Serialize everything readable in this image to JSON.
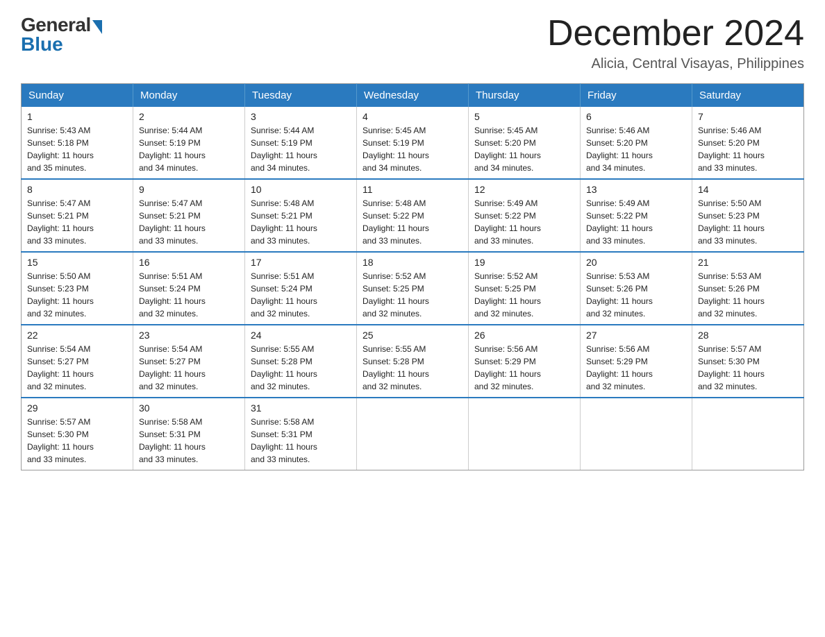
{
  "logo": {
    "general": "General",
    "blue": "Blue"
  },
  "header": {
    "month_title": "December 2024",
    "subtitle": "Alicia, Central Visayas, Philippines"
  },
  "days_of_week": [
    "Sunday",
    "Monday",
    "Tuesday",
    "Wednesday",
    "Thursday",
    "Friday",
    "Saturday"
  ],
  "weeks": [
    [
      {
        "day": "1",
        "sunrise": "5:43 AM",
        "sunset": "5:18 PM",
        "daylight": "11 hours and 35 minutes."
      },
      {
        "day": "2",
        "sunrise": "5:44 AM",
        "sunset": "5:19 PM",
        "daylight": "11 hours and 34 minutes."
      },
      {
        "day": "3",
        "sunrise": "5:44 AM",
        "sunset": "5:19 PM",
        "daylight": "11 hours and 34 minutes."
      },
      {
        "day": "4",
        "sunrise": "5:45 AM",
        "sunset": "5:19 PM",
        "daylight": "11 hours and 34 minutes."
      },
      {
        "day": "5",
        "sunrise": "5:45 AM",
        "sunset": "5:20 PM",
        "daylight": "11 hours and 34 minutes."
      },
      {
        "day": "6",
        "sunrise": "5:46 AM",
        "sunset": "5:20 PM",
        "daylight": "11 hours and 34 minutes."
      },
      {
        "day": "7",
        "sunrise": "5:46 AM",
        "sunset": "5:20 PM",
        "daylight": "11 hours and 33 minutes."
      }
    ],
    [
      {
        "day": "8",
        "sunrise": "5:47 AM",
        "sunset": "5:21 PM",
        "daylight": "11 hours and 33 minutes."
      },
      {
        "day": "9",
        "sunrise": "5:47 AM",
        "sunset": "5:21 PM",
        "daylight": "11 hours and 33 minutes."
      },
      {
        "day": "10",
        "sunrise": "5:48 AM",
        "sunset": "5:21 PM",
        "daylight": "11 hours and 33 minutes."
      },
      {
        "day": "11",
        "sunrise": "5:48 AM",
        "sunset": "5:22 PM",
        "daylight": "11 hours and 33 minutes."
      },
      {
        "day": "12",
        "sunrise": "5:49 AM",
        "sunset": "5:22 PM",
        "daylight": "11 hours and 33 minutes."
      },
      {
        "day": "13",
        "sunrise": "5:49 AM",
        "sunset": "5:22 PM",
        "daylight": "11 hours and 33 minutes."
      },
      {
        "day": "14",
        "sunrise": "5:50 AM",
        "sunset": "5:23 PM",
        "daylight": "11 hours and 33 minutes."
      }
    ],
    [
      {
        "day": "15",
        "sunrise": "5:50 AM",
        "sunset": "5:23 PM",
        "daylight": "11 hours and 32 minutes."
      },
      {
        "day": "16",
        "sunrise": "5:51 AM",
        "sunset": "5:24 PM",
        "daylight": "11 hours and 32 minutes."
      },
      {
        "day": "17",
        "sunrise": "5:51 AM",
        "sunset": "5:24 PM",
        "daylight": "11 hours and 32 minutes."
      },
      {
        "day": "18",
        "sunrise": "5:52 AM",
        "sunset": "5:25 PM",
        "daylight": "11 hours and 32 minutes."
      },
      {
        "day": "19",
        "sunrise": "5:52 AM",
        "sunset": "5:25 PM",
        "daylight": "11 hours and 32 minutes."
      },
      {
        "day": "20",
        "sunrise": "5:53 AM",
        "sunset": "5:26 PM",
        "daylight": "11 hours and 32 minutes."
      },
      {
        "day": "21",
        "sunrise": "5:53 AM",
        "sunset": "5:26 PM",
        "daylight": "11 hours and 32 minutes."
      }
    ],
    [
      {
        "day": "22",
        "sunrise": "5:54 AM",
        "sunset": "5:27 PM",
        "daylight": "11 hours and 32 minutes."
      },
      {
        "day": "23",
        "sunrise": "5:54 AM",
        "sunset": "5:27 PM",
        "daylight": "11 hours and 32 minutes."
      },
      {
        "day": "24",
        "sunrise": "5:55 AM",
        "sunset": "5:28 PM",
        "daylight": "11 hours and 32 minutes."
      },
      {
        "day": "25",
        "sunrise": "5:55 AM",
        "sunset": "5:28 PM",
        "daylight": "11 hours and 32 minutes."
      },
      {
        "day": "26",
        "sunrise": "5:56 AM",
        "sunset": "5:29 PM",
        "daylight": "11 hours and 32 minutes."
      },
      {
        "day": "27",
        "sunrise": "5:56 AM",
        "sunset": "5:29 PM",
        "daylight": "11 hours and 32 minutes."
      },
      {
        "day": "28",
        "sunrise": "5:57 AM",
        "sunset": "5:30 PM",
        "daylight": "11 hours and 32 minutes."
      }
    ],
    [
      {
        "day": "29",
        "sunrise": "5:57 AM",
        "sunset": "5:30 PM",
        "daylight": "11 hours and 33 minutes."
      },
      {
        "day": "30",
        "sunrise": "5:58 AM",
        "sunset": "5:31 PM",
        "daylight": "11 hours and 33 minutes."
      },
      {
        "day": "31",
        "sunrise": "5:58 AM",
        "sunset": "5:31 PM",
        "daylight": "11 hours and 33 minutes."
      },
      null,
      null,
      null,
      null
    ]
  ],
  "labels": {
    "sunrise": "Sunrise:",
    "sunset": "Sunset:",
    "daylight": "Daylight:"
  }
}
